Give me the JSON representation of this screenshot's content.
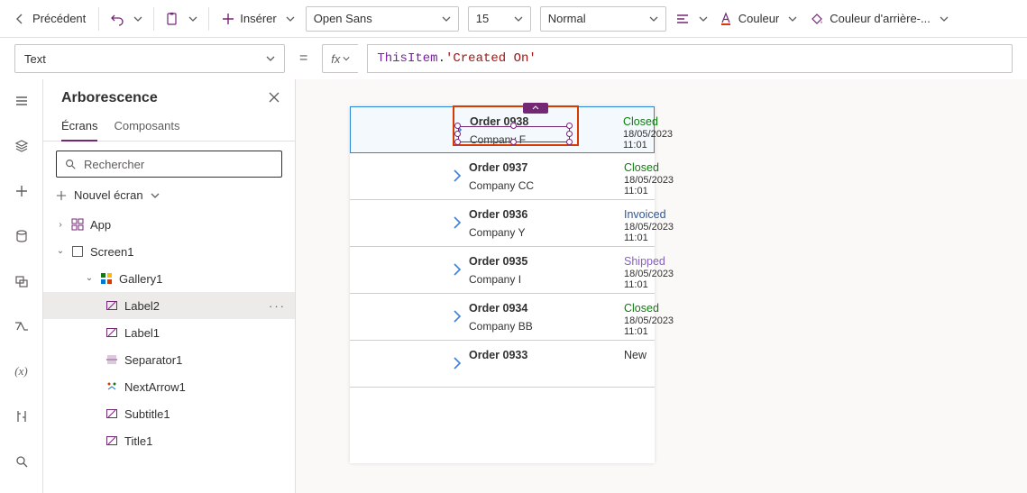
{
  "ribbon": {
    "back_label": "Précédent",
    "insert_label": "Insérer",
    "font_name": "Open Sans",
    "font_size": "15",
    "font_weight": "Normal",
    "color_label": "Couleur",
    "fill_label": "Couleur d'arrière-..."
  },
  "formula": {
    "property": "Text",
    "fx_label": "fx",
    "eq": "=",
    "token_obj": "ThisItem",
    "token_dot": ".",
    "token_prop": "'Created On'"
  },
  "tree": {
    "title": "Arborescence",
    "tab_screens": "Écrans",
    "tab_components": "Composants",
    "search_placeholder": "Rechercher",
    "new_screen_label": "Nouvel écran",
    "nodes": {
      "app": "App",
      "screen1": "Screen1",
      "gallery1": "Gallery1",
      "label2": "Label2",
      "label1": "Label1",
      "separator1": "Separator1",
      "nextarrow1": "NextArrow1",
      "subtitle1": "Subtitle1",
      "title1": "Title1"
    }
  },
  "gallery": [
    {
      "title": "Order 0938",
      "subtitle": "Company F",
      "status": "Closed",
      "date": "18/05/2023 11:01",
      "selected": true
    },
    {
      "title": "Order 0937",
      "subtitle": "Company CC",
      "status": "Closed",
      "date": "18/05/2023 11:01"
    },
    {
      "title": "Order 0936",
      "subtitle": "Company Y",
      "status": "Invoiced",
      "date": "18/05/2023 11:01"
    },
    {
      "title": "Order 0935",
      "subtitle": "Company I",
      "status": "Shipped",
      "date": "18/05/2023 11:01"
    },
    {
      "title": "Order 0934",
      "subtitle": "Company BB",
      "status": "Closed",
      "date": "18/05/2023 11:01"
    },
    {
      "title": "Order 0933",
      "subtitle": "",
      "status": "New",
      "date": ""
    }
  ],
  "rail": {
    "hamburger": "hamburger-icon",
    "layers": "layers-icon",
    "plus": "plus-icon",
    "data": "data-icon",
    "media": "media-icon",
    "flows": "flows-icon",
    "var": "(x)",
    "tools": "tools-icon",
    "search": "search-icon"
  }
}
